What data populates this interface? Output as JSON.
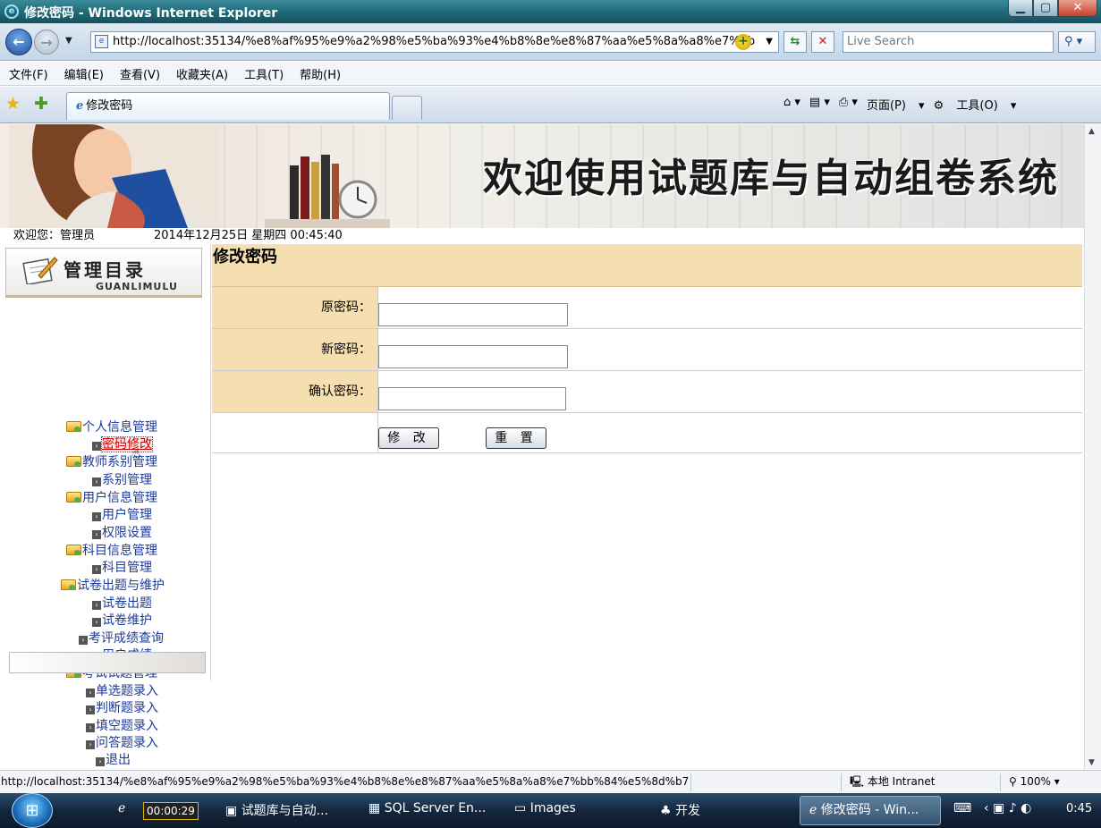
{
  "window": {
    "title": "修改密码 - Windows Internet Explorer"
  },
  "address_bar": {
    "url": "http://localhost:35134/%e8%af%95%e9%a2%98%e5%ba%93%e4%b8%8e%e8%87%aa%e5%8a%a8%e7%bb",
    "search_placeholder": "Live Search"
  },
  "menu": [
    "文件(F)",
    "编辑(E)",
    "查看(V)",
    "收藏夹(A)",
    "工具(T)",
    "帮助(H)"
  ],
  "tab": {
    "title": "修改密码"
  },
  "command_bar": {
    "page": "页面(P)",
    "tools": "工具(O)"
  },
  "banner": {
    "title": "欢迎使用试题库与自动组卷系统"
  },
  "welcome": {
    "user": "欢迎您：管理员",
    "datetime": "2014年12月25日 星期四   00:45:40"
  },
  "sidebar": {
    "heading": "管理目录",
    "subheading": "GUANLIMULU",
    "items": [
      {
        "type": "folder",
        "label": "个人信息管理"
      },
      {
        "type": "link",
        "label": "密码修改"
      },
      {
        "type": "folder",
        "label": "教师系别管理"
      },
      {
        "type": "link",
        "label": "系别管理"
      },
      {
        "type": "folder",
        "label": "用户信息管理"
      },
      {
        "type": "link",
        "label": "用户管理"
      },
      {
        "type": "link",
        "label": "权限设置"
      },
      {
        "type": "folder",
        "label": "科目信息管理"
      },
      {
        "type": "link",
        "label": "科目管理"
      },
      {
        "type": "folder",
        "label": "试卷出题与维护"
      },
      {
        "type": "link",
        "label": "试卷出题"
      },
      {
        "type": "link",
        "label": "试卷维护"
      },
      {
        "type": "link",
        "label": "考评成绩查询"
      },
      {
        "type": "link",
        "label": "用户成绩"
      },
      {
        "type": "folder",
        "label": "考试试题管理"
      },
      {
        "type": "link",
        "label": "单选题录入"
      },
      {
        "type": "link",
        "label": "判断题录入"
      },
      {
        "type": "link",
        "label": "填空题录入"
      },
      {
        "type": "link",
        "label": "问答题录入"
      },
      {
        "type": "link",
        "label": "退出"
      }
    ]
  },
  "page": {
    "title": "修改密码",
    "fields": [
      {
        "label": "原密码：",
        "value": ""
      },
      {
        "label": "新密码：",
        "value": ""
      },
      {
        "label": "确认密码：",
        "value": ""
      }
    ],
    "submit_label": "修 改",
    "reset_label": "重 置"
  },
  "status": {
    "url": "http://localhost:35134/%e8%af%95%e9%a2%98%e5%ba%93%e4%b8%8e%e8%87%aa%e5%8a%a8%e7%bb%84%e5%8d%b7%",
    "zone": "本地 Intranet",
    "zoom": "100%"
  },
  "taskbar": {
    "timer": "00:00:29",
    "items": [
      "试题库与自动...",
      "SQL Server En...",
      "Images",
      "开发",
      "修改密码 - Win..."
    ],
    "clock": "0:45"
  }
}
